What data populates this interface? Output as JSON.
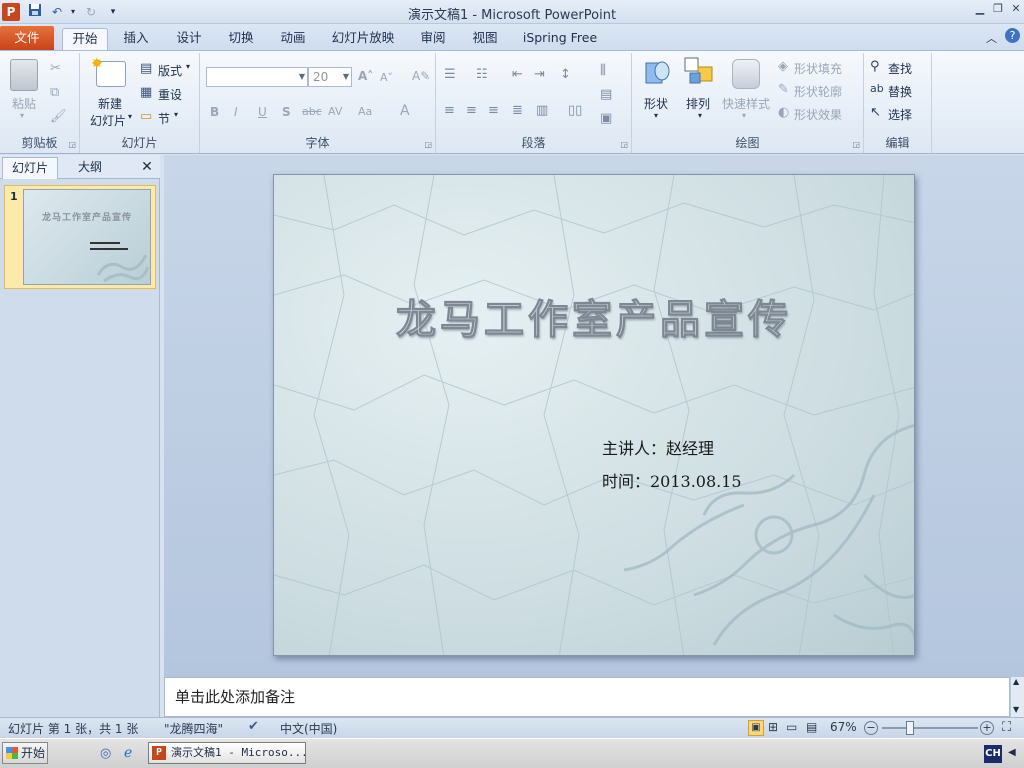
{
  "app": {
    "title": "演示文稿1 - Microsoft PowerPoint",
    "app_icon": "P"
  },
  "tabs": [
    "文件",
    "开始",
    "插入",
    "设计",
    "切换",
    "动画",
    "幻灯片放映",
    "审阅",
    "视图",
    "iSpring Free"
  ],
  "ribbon": {
    "clipboard": {
      "paste": "粘贴",
      "label": "剪贴板"
    },
    "slides": {
      "new_slide_line1": "新建",
      "new_slide_line2": "幻灯片",
      "layout": "版式",
      "reset": "重设",
      "section": "节",
      "label": "幻灯片"
    },
    "font": {
      "font_name": "",
      "font_size": "20",
      "label": "字体",
      "bold": "B",
      "italic": "I",
      "underline": "U",
      "shadow": "S",
      "strike": "abc",
      "spacing": "AV",
      "case": "Aa",
      "color": "A"
    },
    "paragraph": {
      "label": "段落"
    },
    "drawing": {
      "shapes": "形状",
      "arrange": "排列",
      "quick_styles": "快速样式",
      "shape_fill": "形状填充",
      "shape_outline": "形状轮廓",
      "shape_effects": "形状效果",
      "label": "绘图"
    },
    "editing": {
      "find": "查找",
      "replace": "替换",
      "select": "选择",
      "label": "编辑"
    }
  },
  "panel": {
    "tab_slides": "幻灯片",
    "tab_outline": "大纲",
    "close": "✕",
    "slide_number": "1",
    "thumb_title": "龙马工作室产品宣传"
  },
  "slide": {
    "title": "龙马工作室产品宣传",
    "presenter": "主讲人：赵经理",
    "date": "时间：2013.08.15"
  },
  "notes": {
    "placeholder": "单击此处添加备注"
  },
  "status": {
    "slide_info": "幻灯片 第 1 张，共 1 张",
    "theme": "\"龙腾四海\"",
    "language": "中文(中国)",
    "zoom": "67%"
  },
  "taskbar": {
    "start": "开始",
    "window": "演示文稿1 - Microso...",
    "lang": "CH"
  }
}
